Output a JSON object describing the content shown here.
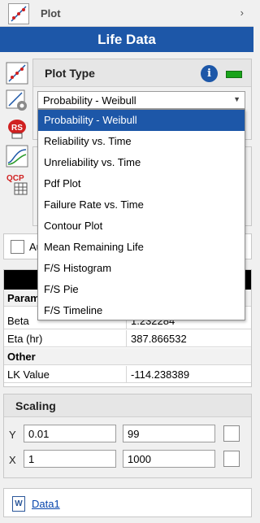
{
  "header": {
    "plot_label": "Plot",
    "chevron": "›"
  },
  "life_title": "Life Data",
  "plot_type": {
    "title": "Plot Type",
    "info_glyph": "i",
    "status_color": "#19a31a",
    "selected": "Probability - Weibull",
    "options": [
      "Probability - Weibull",
      "Reliability vs. Time",
      "Unreliability vs. Time",
      "Pdf Plot",
      "Failure Rate vs. Time",
      "Contour Plot",
      "Mean Remaining Life",
      "F/S Histogram",
      "F/S Pie",
      "F/S Timeline"
    ]
  },
  "auto_row": {
    "label": "Au"
  },
  "results": {
    "param_header": "Param",
    "rows": [
      {
        "key": "Beta",
        "value": "1.232284"
      },
      {
        "key": "Eta (hr)",
        "value": "387.866532"
      }
    ],
    "other_header": "Other",
    "other_rows": [
      {
        "key": "LK Value",
        "value": "-114.238389"
      }
    ]
  },
  "scaling": {
    "title": "Scaling",
    "y_label": "Y",
    "y_min": "0.01",
    "y_max": "99",
    "x_label": "X",
    "x_min": "1",
    "x_max": "1000"
  },
  "data_link": {
    "label": "Data1",
    "icon_glyph": "W"
  },
  "colors": {
    "accent": "#1d57a8",
    "selection": "#1d57a8"
  }
}
